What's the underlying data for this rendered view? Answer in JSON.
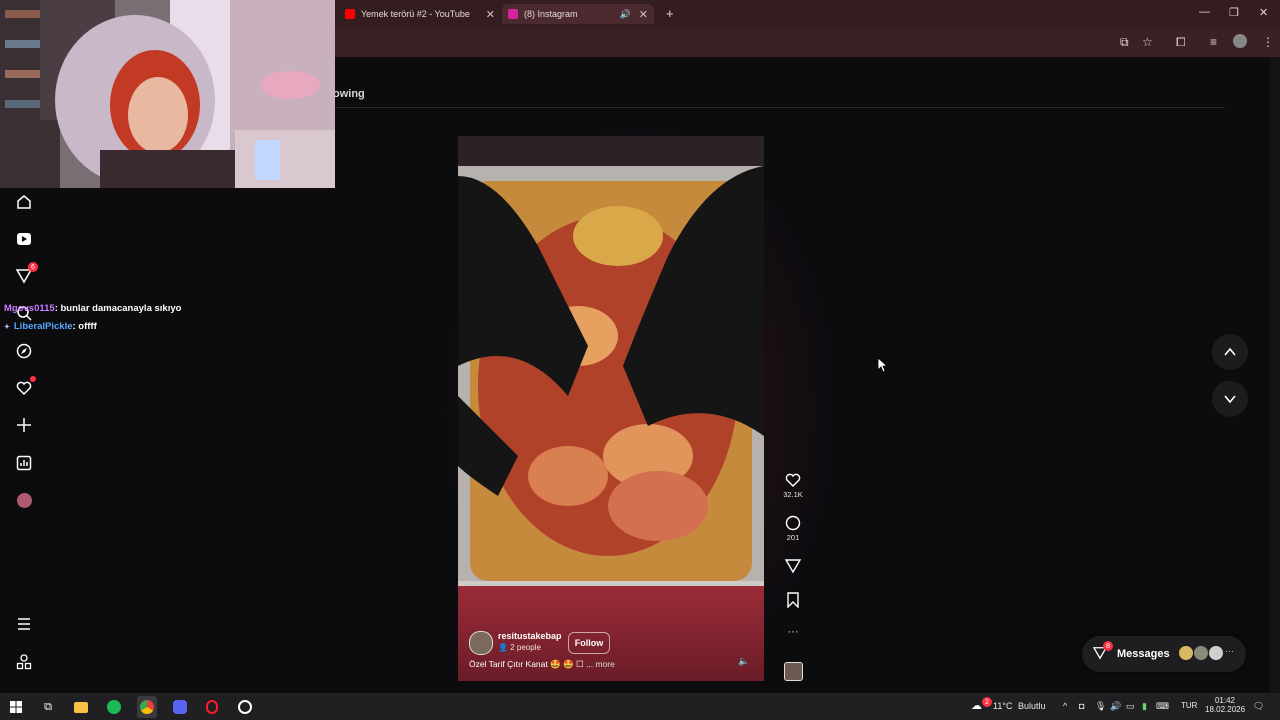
{
  "browser": {
    "tabs": [
      {
        "label": "Yemek terörü #2 - YouTube",
        "favicon_color": "#ff0000"
      },
      {
        "label": "(8) Instagram",
        "favicon_color": "#d6249f"
      }
    ],
    "new_tab": "+"
  },
  "feed": {
    "tab_label": "owing"
  },
  "nav": {
    "notifications_badge": "6"
  },
  "chat": [
    {
      "user": "Mgovs0115",
      "user_color": "#c67bff",
      "text": ": bunlar damacanayla sıkıyo"
    },
    {
      "user": "LiberalPickle",
      "user_color": "#57a8ff",
      "text": ": offff"
    }
  ],
  "reel": {
    "username": "resitustakebap",
    "people": "2 people",
    "follow_label": "Follow",
    "caption": "Özel Tarif Çıtır Kanat 🤩 🤩 ☐ ...",
    "more_label": "more",
    "likes": "32.1K",
    "comments": "201"
  },
  "messages": {
    "label": "Messages",
    "badge": "8"
  },
  "taskbar": {
    "weather_temp": "11°C",
    "weather_text": "Bulutlu",
    "weather_badge": "2",
    "lang": "TUR",
    "time": "01:42",
    "date": "18.02.2026"
  },
  "colors": {
    "accent_red": "#ff3040",
    "reel_gradient": "#9b2b38"
  }
}
